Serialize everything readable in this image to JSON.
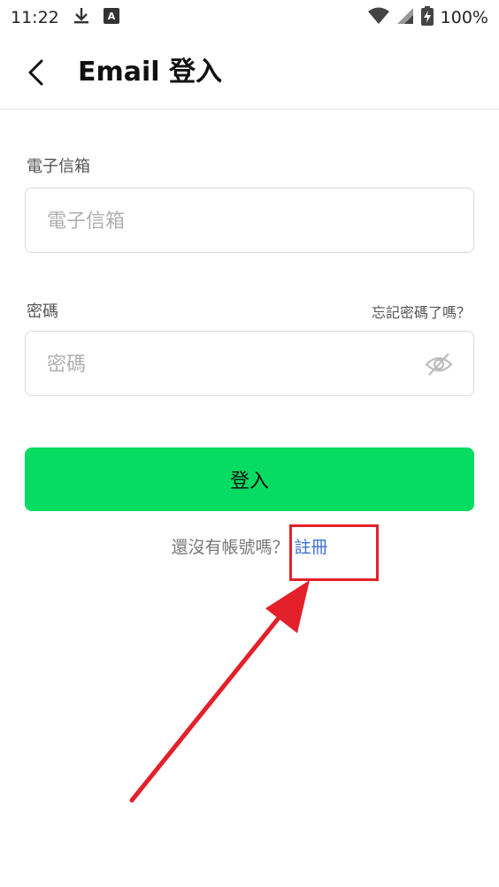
{
  "status_bar": {
    "time": "11:22",
    "battery": "100%",
    "icons": [
      "download-icon",
      "translate-icon",
      "wifi-icon",
      "signal-icon",
      "battery-charging-icon"
    ]
  },
  "header": {
    "title": "Email 登入",
    "back_icon": "chevron-left-icon"
  },
  "form": {
    "email_label": "電子信箱",
    "email_placeholder": "電子信箱",
    "email_value": "",
    "password_label": "密碼",
    "password_placeholder": "密碼",
    "password_value": "",
    "forgot_link": "忘記密碼了嗎？",
    "visibility_icon": "eye-off-icon",
    "login_button": "登入"
  },
  "signup": {
    "question": "還沒有帳號嗎？",
    "link": "註冊"
  },
  "colors": {
    "primary_green": "#06dc62",
    "link_blue": "#3b6fd6",
    "annotation_red": "#e4202a"
  }
}
